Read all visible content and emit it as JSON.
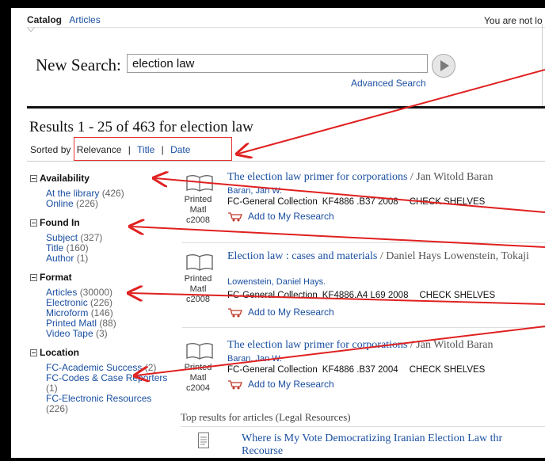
{
  "nav": {
    "tabs": [
      {
        "label": "Catalog",
        "active": true
      },
      {
        "label": "Articles",
        "active": false
      }
    ],
    "login_note": "You are not lo"
  },
  "search": {
    "label": "New Search:",
    "value": "election law",
    "advanced_label": "Advanced Search",
    "go_icon": "play-arrow-icon"
  },
  "results": {
    "title": "Results 1 - 25 of 463 for election law",
    "sort_prefix": "Sorted by",
    "sort_options": [
      "Relevance",
      "Title",
      "Date"
    ],
    "sort_separator": "|"
  },
  "facets": [
    {
      "name": "Availability",
      "items": [
        {
          "label": "At the library",
          "count": "(426)"
        },
        {
          "label": "Online",
          "count": "(226)"
        }
      ]
    },
    {
      "name": "Found In",
      "items": [
        {
          "label": "Subject",
          "count": "(327)"
        },
        {
          "label": "Title",
          "count": "(160)"
        },
        {
          "label": "Author",
          "count": "(1)"
        }
      ]
    },
    {
      "name": "Format",
      "items": [
        {
          "label": "Articles",
          "count": "(30000)"
        },
        {
          "label": "Electronic",
          "count": "(226)"
        },
        {
          "label": "Microform",
          "count": "(146)"
        },
        {
          "label": "Printed Matl",
          "count": "(88)"
        },
        {
          "label": "Video Tape",
          "count": "(3)"
        }
      ]
    },
    {
      "name": "Location",
      "items": [
        {
          "label": "FC-Academic Success",
          "count": "(2)"
        },
        {
          "label": "FC-Codes & Case Reporters",
          "count": "(1)"
        },
        {
          "label": "FC-Electronic Resources",
          "count": "(226)"
        }
      ]
    }
  ],
  "records": [
    {
      "title": "The election law primer for corporations",
      "title_author": " / Jan Witold Baran",
      "author": "Baran, Jan W.",
      "collection": "FC-General Collection",
      "call_number": "KF4886 .B37 2008",
      "status": "CHECK SHELVES",
      "format_line1": "Printed",
      "format_line2": "Matl",
      "year": "c2008",
      "add_label": "Add to My Research"
    },
    {
      "title": "Election law : cases and materials",
      "title_author": " / Daniel Hays Lowenstein, Tokaji",
      "author": "Lowenstein, Daniel Hays.",
      "collection": "FC-General Collection",
      "call_number": "KF4886.A4 L69 2008",
      "status": "CHECK SHELVES",
      "format_line1": "Printed",
      "format_line2": "Matl",
      "year": "c2008",
      "add_label": "Add to My Research"
    },
    {
      "title": "The election law primer for corporations",
      "title_author": " / Jan Witold Baran",
      "author": "Baran, Jan W.",
      "collection": "FC-General Collection",
      "call_number": "KF4886 .B37 2004",
      "status": "CHECK SHELVES",
      "format_line1": "Printed",
      "format_line2": "Matl",
      "year": "c2004",
      "add_label": "Add to My Research"
    }
  ],
  "articles": {
    "heading": "Top results for articles (Legal Resources)",
    "first_title_line1": "Where is My Vote Democratizing Iranian Election Law thr",
    "first_title_line2": "Recourse"
  },
  "colors": {
    "link": "#1a4fa0",
    "annotation": "#e02020",
    "frame": "#000000"
  }
}
